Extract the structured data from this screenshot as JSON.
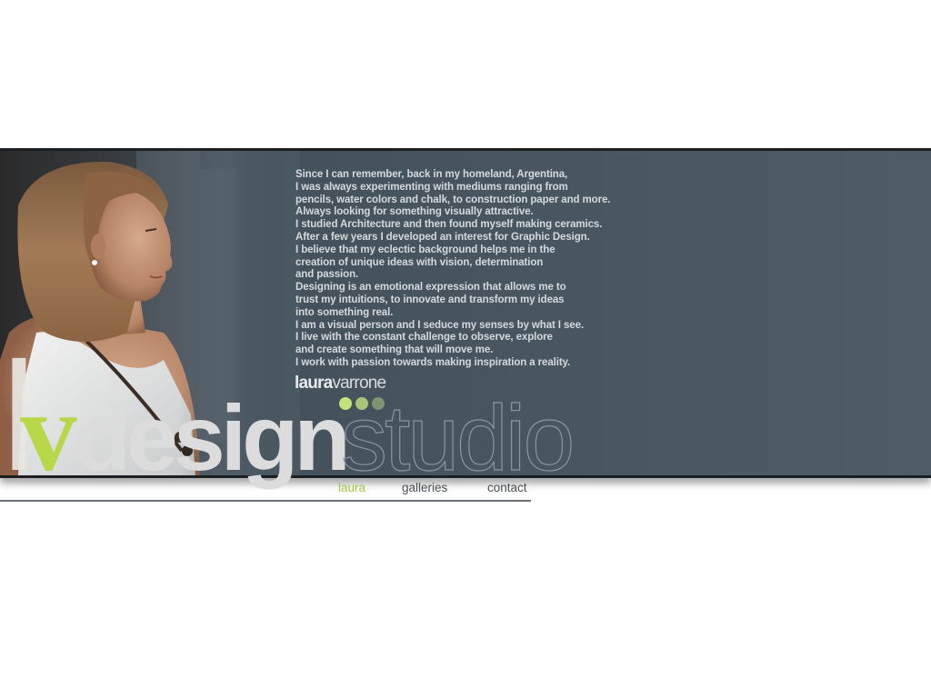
{
  "bio_lines": [
    "Since I can remember, back in my homeland, Argentina,",
    "I was always experimenting with mediums ranging from",
    "pencils, water colors and chalk, to construction paper and more.",
    "Always looking for something visually attractive.",
    "I studied Architecture and then found myself making ceramics.",
    "After a few years  I developed an interest for Graphic Design.",
    "I believe that my eclectic background helps me in the",
    "creation of unique ideas with vision, determination",
    "and passion.",
    "Designing is an emotional expression that allows me to",
    "trust my intuitions, to innovate and transform my ideas",
    "into something real.",
    "I am a visual person and I seduce my senses by what I see.",
    "I live with  the constant challenge to observe, explore",
    "and create something that will move me.",
    "I work with passion towards making inspiration a reality."
  ],
  "signature": {
    "first": "laura",
    "last": "varrone"
  },
  "logo": {
    "l": "l",
    "v": "v",
    "design": "design",
    "studio": "studio"
  },
  "nav": {
    "laura": "laura",
    "galleries": "galleries",
    "contact": "contact"
  },
  "colors": {
    "accent_green": "#b8d84a",
    "dot_1": "#c5e27a",
    "dot_2": "#a9c478",
    "dot_3": "#7f9272",
    "nav_active": "#a6c93c",
    "nav_text": "#4a4f54",
    "banner": "#4a5862",
    "bio_text": "#d5d9dc"
  },
  "icons": {
    "dots": "three-dots-decoration"
  }
}
